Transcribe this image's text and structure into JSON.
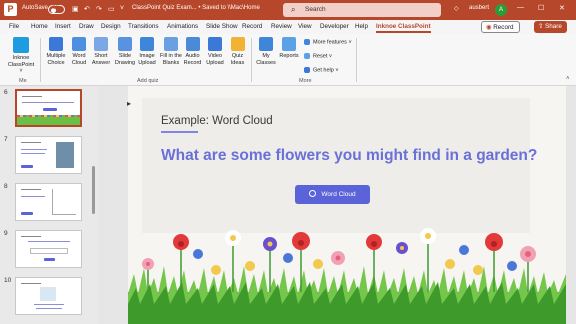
{
  "titlebar": {
    "app_letter": "P",
    "autosave_label": "AutoSave",
    "autosave_state": "Off",
    "file_title": "ClassPoint Quiz Exam... • Saved to \\\\Mac\\Home",
    "search_placeholder": "Search",
    "user_name": "ausbert",
    "user_initial": "A",
    "brand_color": "#b7472a"
  },
  "tabs": {
    "items": [
      "File",
      "Home",
      "Insert",
      "Draw",
      "Design",
      "Transitions",
      "Animations",
      "Slide Show",
      "Record",
      "Review",
      "View",
      "Developer",
      "Help",
      "Inknoe ClassPoint"
    ],
    "active": "Inknoe ClassPoint",
    "record_label": "Record",
    "share_label": "Share"
  },
  "ribbon": {
    "me_group_label": "Me",
    "add_quiz_group_label": "Add quiz",
    "more_group_label": "More",
    "inknoe_btn": [
      "Inknoe",
      "ClassPoint ˅"
    ],
    "quiz_buttons": [
      [
        "Multiple",
        "Choice"
      ],
      [
        "Word",
        "Cloud"
      ],
      [
        "Short",
        "Answer"
      ],
      [
        "Slide",
        "Drawing"
      ],
      [
        "Image",
        "Upload"
      ],
      [
        "Fill in the",
        "Blanks"
      ],
      [
        "Audio",
        "Record"
      ],
      [
        "Video",
        "Upload"
      ],
      [
        "Quiz",
        "Ideas"
      ]
    ],
    "more_buttons": [
      [
        "My",
        "Classes"
      ],
      [
        "Reports"
      ]
    ],
    "small_cmds": [
      "More features ˅",
      "Reset ˅",
      "Get help ˅"
    ]
  },
  "slides_pane": {
    "numbers": [
      "6",
      "7",
      "8",
      "9",
      "10"
    ],
    "selected": "6"
  },
  "slide": {
    "title": "Example: Word Cloud",
    "question": "What are some flowers you might find in a garden?",
    "button_label": "Word Cloud",
    "accent_color": "#5b63d8"
  }
}
